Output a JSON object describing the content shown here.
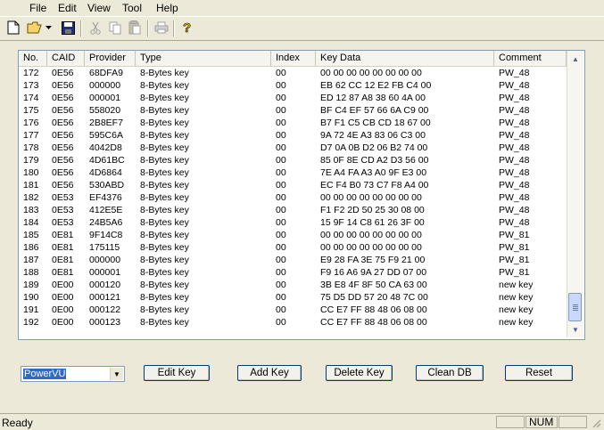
{
  "menu": [
    "File",
    "Edit",
    "View",
    "Tool",
    "Help"
  ],
  "toolbar_icons": [
    "new-file-icon",
    "open-folder-icon",
    "dropdown-arrow-icon",
    "save-icon",
    "cut-icon",
    "copy-icon",
    "paste-icon",
    "print-icon",
    "help-icon"
  ],
  "table": {
    "columns": [
      "No.",
      "CAID",
      "Provider",
      "Type",
      "Index",
      "Key Data",
      "Comment"
    ],
    "rows": [
      [
        "172",
        "0E56",
        "68DFA9",
        "8-Bytes key",
        "00",
        "00 00 00 00 00 00 00 00",
        "PW_48"
      ],
      [
        "173",
        "0E56",
        "000000",
        "8-Bytes key",
        "00",
        "EB 62 CC 12 E2 FB C4 00",
        "PW_48"
      ],
      [
        "174",
        "0E56",
        "000001",
        "8-Bytes key",
        "00",
        "ED 12 87 A8 38 60 4A 00",
        "PW_48"
      ],
      [
        "175",
        "0E56",
        "558020",
        "8-Bytes key",
        "00",
        "BF C4 EF 57 66 6A C9 00",
        "PW_48"
      ],
      [
        "176",
        "0E56",
        "2B8EF7",
        "8-Bytes key",
        "00",
        "B7 F1 C5 CB CD 18 67 00",
        "PW_48"
      ],
      [
        "177",
        "0E56",
        "595C6A",
        "8-Bytes key",
        "00",
        "9A 72 4E A3 83 06 C3 00",
        "PW_48"
      ],
      [
        "178",
        "0E56",
        "4042D8",
        "8-Bytes key",
        "00",
        "D7 0A 0B D2 06 B2 74 00",
        "PW_48"
      ],
      [
        "179",
        "0E56",
        "4D61BC",
        "8-Bytes key",
        "00",
        "85 0F 8E CD A2 D3 56 00",
        "PW_48"
      ],
      [
        "180",
        "0E56",
        "4D6864",
        "8-Bytes key",
        "00",
        "7E A4 FA A3 A0 9F E3 00",
        "PW_48"
      ],
      [
        "181",
        "0E56",
        "530ABD",
        "8-Bytes key",
        "00",
        "EC F4 B0 73 C7 F8 A4 00",
        "PW_48"
      ],
      [
        "182",
        "0E53",
        "EF4376",
        "8-Bytes key",
        "00",
        "00 00 00 00 00 00 00 00",
        "PW_48"
      ],
      [
        "183",
        "0E53",
        "412E5E",
        "8-Bytes key",
        "00",
        "F1 F2 2D 50 25 30 08 00",
        "PW_48"
      ],
      [
        "184",
        "0E53",
        "24B5A6",
        "8-Bytes key",
        "00",
        "15 9F 14 C8 61 26 3F 00",
        "PW_48"
      ],
      [
        "185",
        "0E81",
        "9F14C8",
        "8-Bytes key",
        "00",
        "00 00 00 00 00 00 00 00",
        "PW_81"
      ],
      [
        "186",
        "0E81",
        "175115",
        "8-Bytes key",
        "00",
        "00 00 00 00 00 00 00 00",
        "PW_81"
      ],
      [
        "187",
        "0E81",
        "000000",
        "8-Bytes key",
        "00",
        "E9 28 FA 3E 75 F9 21 00",
        "PW_81"
      ],
      [
        "188",
        "0E81",
        "000001",
        "8-Bytes key",
        "00",
        "F9 16 A6 9A 27 DD 07 00",
        "PW_81"
      ],
      [
        "189",
        "0E00",
        "000120",
        "8-Bytes key",
        "00",
        "3B E8 4F 8F 50 CA 63 00",
        "new key"
      ],
      [
        "190",
        "0E00",
        "000121",
        "8-Bytes key",
        "00",
        "75 D5 DD 57 20 48 7C 00",
        "new key"
      ],
      [
        "191",
        "0E00",
        "000122",
        "8-Bytes key",
        "00",
        "CC E7 FF 88 48 06 08 00",
        "new key"
      ],
      [
        "192",
        "0E00",
        "000123",
        "8-Bytes key",
        "00",
        "CC E7 FF 88 48 06 08 00",
        "new key"
      ]
    ]
  },
  "provider_select": {
    "value": "PowerVU"
  },
  "buttons": {
    "edit_key": "Edit Key",
    "add_key": "Add Key",
    "delete_key": "Delete Key",
    "clean_db": "Clean DB",
    "reset": "Reset"
  },
  "status": {
    "text": "Ready",
    "num": "NUM"
  }
}
